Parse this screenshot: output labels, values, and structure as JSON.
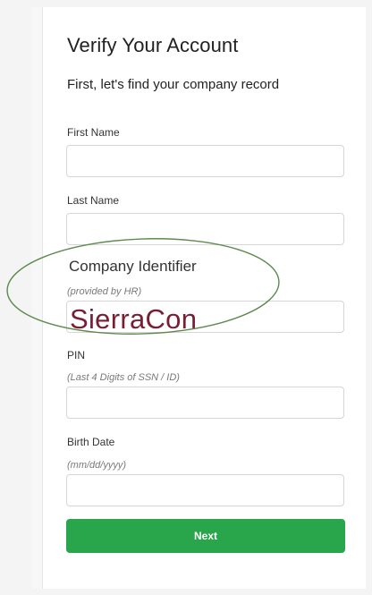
{
  "form": {
    "title": "Verify Your Account",
    "subtitle": "First, let's find your company record",
    "first_name": {
      "label": "First Name",
      "value": ""
    },
    "last_name": {
      "label": "Last Name",
      "value": ""
    },
    "company": {
      "label": "Company Identifier",
      "hint": "(provided by HR)",
      "value": "SierraCon"
    },
    "pin": {
      "label": "PIN",
      "hint": "(Last 4 Digits of SSN / ID)",
      "value": ""
    },
    "birth_date": {
      "label": "Birth Date",
      "hint": "(mm/dd/yyyy)",
      "value": ""
    },
    "next_label": "Next"
  },
  "colors": {
    "button": "#29a54b",
    "handwriting": "#7a1c33",
    "annotation": "#5e8a4e"
  }
}
